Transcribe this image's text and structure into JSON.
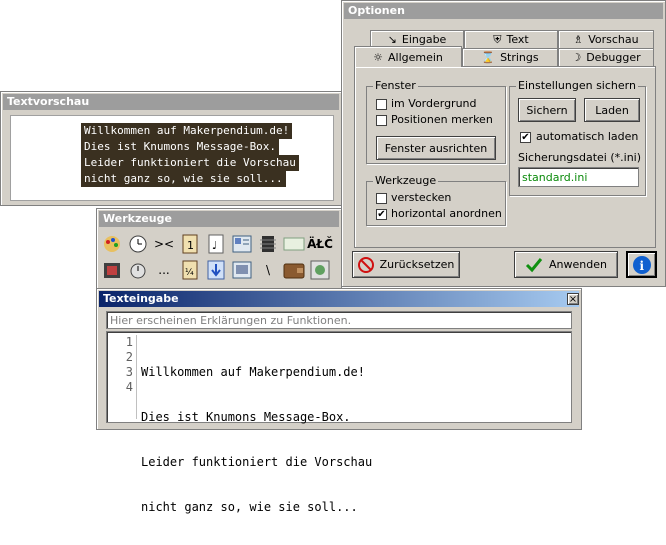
{
  "textvorschau": {
    "title": "Textvorschau",
    "lines": [
      "Willkommen auf Makerpendium.de!",
      "Dies ist Knumons Message-Box.",
      "Leider funktioniert die Vorschau",
      "nicht ganz so, wie sie soll..."
    ]
  },
  "werkzeuge": {
    "title": "Werkzeuge",
    "row1": [
      "palette-icon",
      "clock-icon",
      "><",
      "page-1-icon",
      "music-note-icon",
      "picture-icon",
      "chip-icon",
      "blank-icon",
      "ÄŁČ"
    ],
    "row2": [
      "film-icon",
      "clock-page-icon",
      "...",
      "page-half-icon",
      "download-arrow-icon",
      "image-icon",
      "\\",
      "wallet-icon",
      "dial-icon"
    ]
  },
  "optionen": {
    "title": "Optionen",
    "tabs_row1": [
      {
        "label": "Eingabe",
        "icon": "cursor-icon"
      },
      {
        "label": "Text",
        "icon": "shield-icon"
      },
      {
        "label": "Vorschau",
        "icon": "chess-icon"
      }
    ],
    "tabs_row2": [
      {
        "label": "Allgemein",
        "icon": "sun-icon"
      },
      {
        "label": "Strings",
        "icon": "hourglass-icon"
      },
      {
        "label": "Debugger",
        "icon": "moon-icon"
      }
    ],
    "fenster": {
      "label": "Fenster",
      "im_vordergrund": "im Vordergrund",
      "positionen_merken": "Positionen merken",
      "ausrichten_button": "Fenster ausrichten"
    },
    "werkzeuge_group": {
      "label": "Werkzeuge",
      "verstecken": "verstecken",
      "horizontal": "horizontal anordnen",
      "horizontal_checked": true
    },
    "einstellungen": {
      "label": "Einstellungen sichern",
      "sichern": "Sichern",
      "laden": "Laden",
      "auto_laden": "automatisch laden",
      "auto_laden_checked": true,
      "datei_label": "Sicherungsdatei (*.ini)",
      "datei_value": "standard.ini"
    },
    "reset_button": "Zurücksetzen",
    "apply_button": "Anwenden"
  },
  "texteingabe": {
    "title": "Texteingabe",
    "hint": "Hier erscheinen Erklärungen zu Funktionen.",
    "close": "×",
    "line_numbers": [
      "1",
      "2",
      "3",
      "4"
    ],
    "lines": [
      "Willkommen auf Makerpendium.de!",
      "Dies ist Knumons Message-Box.",
      "Leider funktioniert die Vorschau",
      "nicht ganz so, wie sie soll..."
    ]
  },
  "colors": {
    "preview_text_bg": "#3a3020",
    "inactive_title": "#9d9d9d",
    "accent_green": "#0a8a0a"
  }
}
